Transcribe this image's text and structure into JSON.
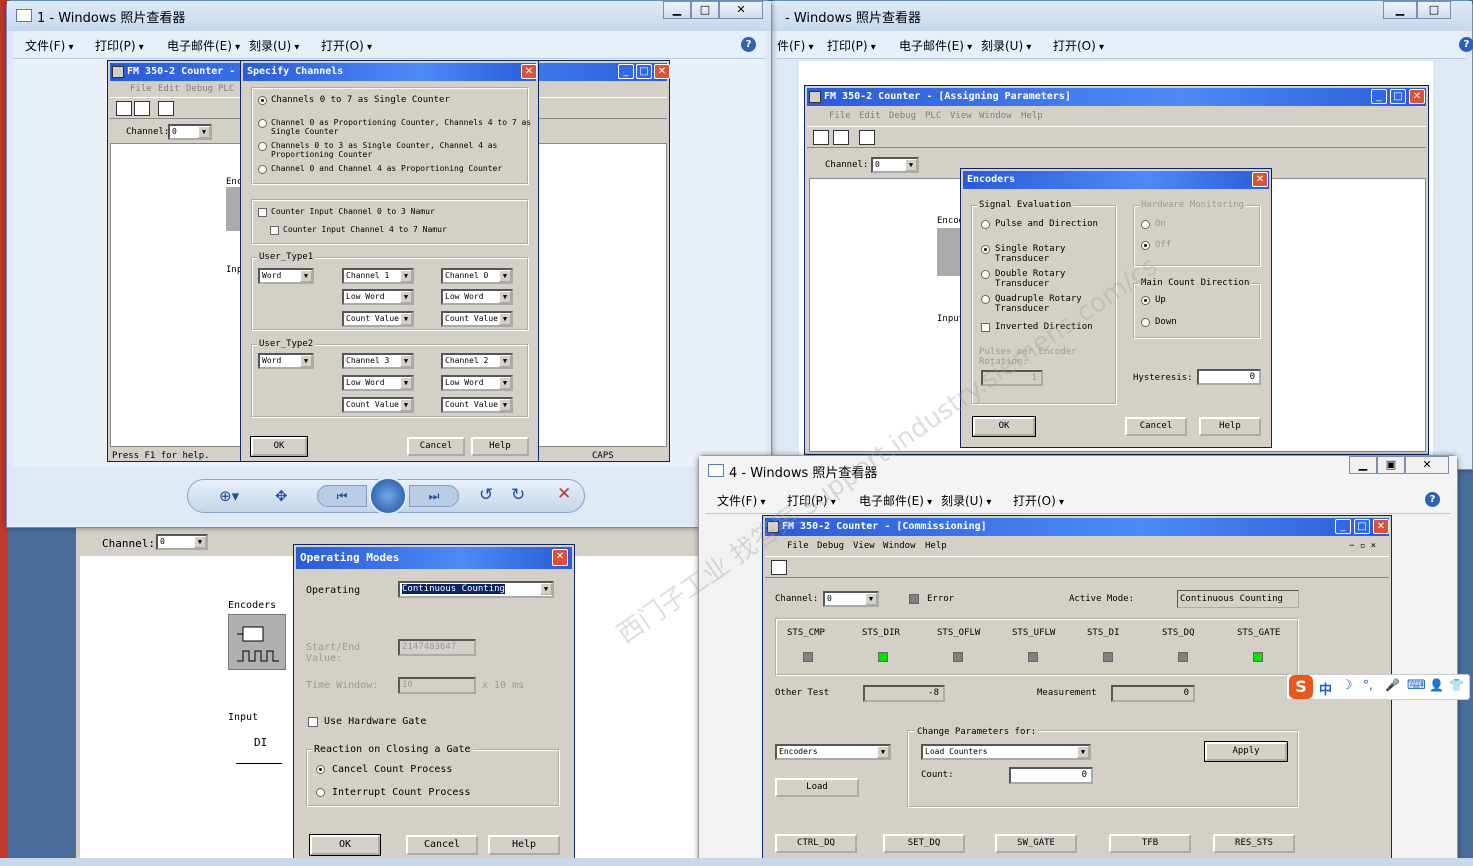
{
  "win1": {
    "title": "1 - Windows 照片查看器",
    "menu": [
      "文件(F)",
      "打印(P)",
      "电子邮件(E)",
      "刻录(U)",
      "打开(O)"
    ]
  },
  "win2": {
    "title": "- Windows 照片查看器",
    "menu": [
      "件(F)",
      "打印(P)",
      "电子邮件(E)",
      "刻录(U)",
      "打开(O)"
    ]
  },
  "win4": {
    "title": "4 - Windows 照片查看器",
    "menu": [
      "文件(F)",
      "打印(P)",
      "电子邮件(E)",
      "刻录(U)",
      "打开(O)"
    ]
  },
  "fm1": {
    "title": "FM 350-2 Counter -",
    "menu": [
      "File",
      "Edit",
      "Debug",
      "PLC"
    ],
    "channel_label": "Channel:",
    "channel_value": "0",
    "status": "Press F1 for help.",
    "caps": "CAPS",
    "enc_label": "Enc",
    "inp_label": "Inp"
  },
  "specify": {
    "title": "Specify Channels",
    "options": [
      "Channels 0 to 7 as Single Counter",
      "Channel 0 as Proportioning Counter, Channels 4 to 7 as",
      "Single Counter",
      "Channels 0 to 3 as Single Counter, Channel 4 as",
      "Proportioning Counter",
      "Channel 0 and Channel 4 as Proportioning Counter"
    ],
    "namur": [
      "Counter Input Channel 0 to 3 Namur",
      "Counter Input Channel 4 to 7 Namur"
    ],
    "ut1": {
      "label": "User_Type1",
      "word": "Word",
      "c1": [
        "Channel 1",
        "Low Word",
        "Count Value"
      ],
      "c2": [
        "Channel 0",
        "Low Word",
        "Count Value"
      ]
    },
    "ut2": {
      "label": "User_Type2",
      "word": "Word",
      "c1": [
        "Channel 3",
        "Low Word",
        "Count Value"
      ],
      "c2": [
        "Channel 2",
        "Low Word",
        "Count Value"
      ]
    },
    "ok": "OK",
    "cancel": "Cancel",
    "help": "Help"
  },
  "fm2": {
    "title": "FM 350-2 Counter - [Assigning Parameters]",
    "menu": [
      "File",
      "Edit",
      "Debug",
      "PLC",
      "View",
      "Window",
      "Help"
    ],
    "channel_label": "Channel:",
    "channel_value": "0",
    "enc_label": "Encod",
    "inp_label": "Input"
  },
  "encoders": {
    "title": "Encoders",
    "signal_eval": "Signal Evaluation",
    "pulse": "Pulse and Direction",
    "single": [
      "Single Rotary",
      "Transducer"
    ],
    "double": [
      "Double Rotary",
      "Transducer"
    ],
    "quad": [
      "Quadruple Rotary",
      "Transducer"
    ],
    "inverted": "Inverted Direction",
    "pulses": [
      "Pulses per Encoder",
      "Rotation:"
    ],
    "pulses_val": "1",
    "hw_mon": "Hardware Monitoring",
    "on": "On",
    "off": "Off",
    "main_dir": "Main Count Direction",
    "up": "Up",
    "down": "Down",
    "hysteresis": "Hysteresis:",
    "hyst_val": "0",
    "ok": "OK",
    "cancel": "Cancel",
    "help": "Help"
  },
  "fm3": {
    "channel_label": "Channel:",
    "channel_value": "0",
    "encoders": "Encoders",
    "input": "Input",
    "di": "DI"
  },
  "opmodes": {
    "title": "Operating Modes",
    "operating": "Operating",
    "mode": "Continuous Counting",
    "start_end": [
      "Start/End",
      "Value:"
    ],
    "start_val": "2147483647",
    "time_window": "Time Window:",
    "time_val": "10",
    "time_unit": "x 10 ms",
    "hw_gate": "Use Hardware Gate",
    "reaction": "Reaction on Closing a Gate",
    "cancel_proc": "Cancel Count Process",
    "interrupt_proc": "Interrupt Count Process",
    "ok": "OK",
    "cancel": "Cancel",
    "help": "Help"
  },
  "fm4": {
    "title": "FM 350-2 Counter - [Commissioning]",
    "menu": [
      "File",
      "Debug",
      "View",
      "Window",
      "Help"
    ],
    "channel_label": "Channel:",
    "channel_value": "0",
    "error": "Error",
    "active_mode_label": "Active Mode:",
    "active_mode": "Continuous Counting",
    "sts": [
      {
        "name": "STS_CMP",
        "on": false
      },
      {
        "name": "STS_DIR",
        "on": true
      },
      {
        "name": "STS_OFLW",
        "on": false
      },
      {
        "name": "STS_UFLW",
        "on": false
      },
      {
        "name": "STS_DI",
        "on": false
      },
      {
        "name": "STS_DQ",
        "on": false
      },
      {
        "name": "STS_GATE",
        "on": true
      }
    ],
    "other_test": "Other Test",
    "other_val": "-8",
    "measurement": "Measurement",
    "meas_val": "0",
    "change_params": "Change Parameters for:",
    "sel_left": "Encoders",
    "sel_right": "Load Counters",
    "apply": "Apply",
    "count": "Count:",
    "count_val": "0",
    "load": "Load",
    "cmds": [
      "CTRL_DQ",
      "SET_DQ",
      "SW_GATE",
      "TFB",
      "RES_STS"
    ]
  },
  "ime": [
    "中",
    "☽",
    "°,",
    "🎤",
    "⌨",
    "👤",
    "👕"
  ],
  "ime_logo": "S",
  "watermark": "西门子工业 找答案 support.industry.siemens.com/cs"
}
